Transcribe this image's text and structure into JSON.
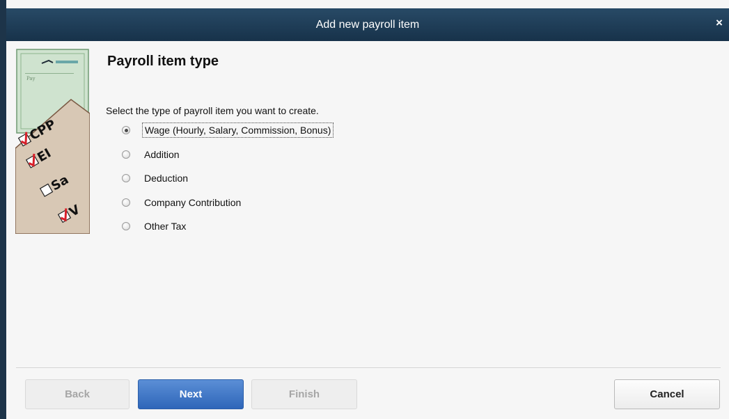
{
  "window": {
    "title": "Add new payroll item",
    "close_glyph": "×"
  },
  "page": {
    "heading": "Payroll item type",
    "prompt": "Select the type of payroll item you want to create."
  },
  "illustration": {
    "checklist": [
      "CPP",
      "EI",
      "Sa",
      "V"
    ]
  },
  "options": [
    {
      "label": "Wage (Hourly, Salary, Commission, Bonus)",
      "checked": true
    },
    {
      "label": "Addition",
      "checked": false
    },
    {
      "label": "Deduction",
      "checked": false
    },
    {
      "label": "Company Contribution",
      "checked": false
    },
    {
      "label": "Other Tax",
      "checked": false
    }
  ],
  "buttons": {
    "back": "Back",
    "next": "Next",
    "finish": "Finish",
    "cancel": "Cancel"
  },
  "colors": {
    "titlebar": "#1d3449",
    "primary_button": "#3a73c4",
    "check_mark": "#d8202a"
  }
}
